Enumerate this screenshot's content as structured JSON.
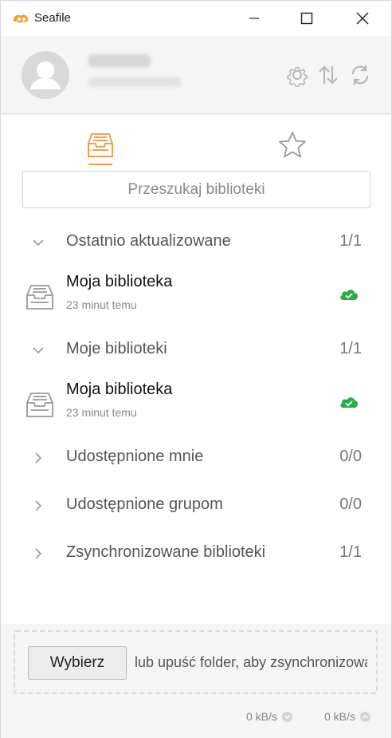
{
  "window": {
    "title": "Seafile",
    "accent_color": "#f0a050"
  },
  "tabs": [
    {
      "name": "libraries",
      "icon": "library-tray-icon",
      "active": true
    },
    {
      "name": "starred",
      "icon": "star-icon",
      "active": false
    }
  ],
  "search": {
    "placeholder": "Przeszukaj biblioteki"
  },
  "groups": [
    {
      "label": "Ostatnio aktualizowane",
      "count": "1/1",
      "expanded": true,
      "items": [
        {
          "name": "Moja biblioteka",
          "time": "23 minut temu",
          "status": "synced"
        }
      ]
    },
    {
      "label": "Moje biblioteki",
      "count": "1/1",
      "expanded": true,
      "items": [
        {
          "name": "Moja biblioteka",
          "time": "23 minut temu",
          "status": "synced"
        }
      ]
    },
    {
      "label": "Udostępnione mnie",
      "count": "0/0",
      "expanded": false,
      "items": []
    },
    {
      "label": "Udostępnione grupom",
      "count": "0/0",
      "expanded": false,
      "items": []
    },
    {
      "label": "Zsynchronizowane biblioteki",
      "count": "1/1",
      "expanded": false,
      "items": []
    }
  ],
  "footer": {
    "choose_label": "Wybierz",
    "drop_text": "lub upuść folder, aby zsynchronizować",
    "download_rate": "0 kB/s",
    "upload_rate": "0 kB/s"
  },
  "status_color": "#2daa4a"
}
